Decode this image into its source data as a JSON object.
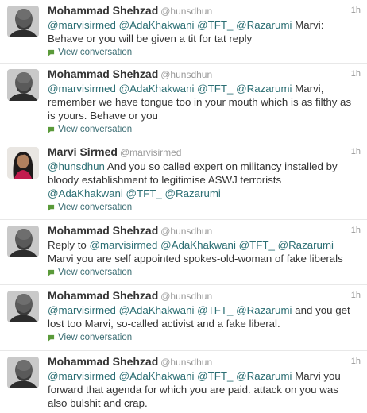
{
  "tweets": [
    {
      "author": "Mohammad Shehzad",
      "handle": "@hunsdhun",
      "time": "1h",
      "avatar": "bald-man-avatar",
      "segments": [
        {
          "t": "@marvisirmed",
          "m": true
        },
        {
          "t": " ",
          "m": false
        },
        {
          "t": "@AdaKhakwani",
          "m": true
        },
        {
          "t": " ",
          "m": false
        },
        {
          "t": "@TFT_",
          "m": true
        },
        {
          "t": " ",
          "m": false
        },
        {
          "t": "@Razarumi",
          "m": true
        },
        {
          "t": " Marvi: Behave or you will be given a tit for tat reply",
          "m": false
        }
      ],
      "action": "View conversation"
    },
    {
      "author": "Mohammad Shehzad",
      "handle": "@hunsdhun",
      "time": "1h",
      "avatar": "bald-man-avatar",
      "segments": [
        {
          "t": "@marvisirmed",
          "m": true
        },
        {
          "t": " ",
          "m": false
        },
        {
          "t": "@AdaKhakwani",
          "m": true
        },
        {
          "t": " ",
          "m": false
        },
        {
          "t": "@TFT_",
          "m": true
        },
        {
          "t": " ",
          "m": false
        },
        {
          "t": "@Razarumi",
          "m": true
        },
        {
          "t": " Marvi, remember we have tongue too in your mouth which is as filthy as is yours. Behave or you",
          "m": false
        }
      ],
      "action": "View conversation"
    },
    {
      "author": "Marvi Sirmed",
      "handle": "@marvisirmed",
      "time": "1h",
      "avatar": "woman-avatar",
      "segments": [
        {
          "t": "@hunsdhun",
          "m": true
        },
        {
          "t": " And you so called expert on militancy installed by bloody establishment to legitimise ASWJ terrorists ",
          "m": false
        },
        {
          "t": "@AdaKhakwani",
          "m": true
        },
        {
          "t": " ",
          "m": false
        },
        {
          "t": "@TFT_",
          "m": true
        },
        {
          "t": " ",
          "m": false
        },
        {
          "t": "@Razarumi",
          "m": true
        }
      ],
      "action": "View conversation"
    },
    {
      "author": "Mohammad Shehzad",
      "handle": "@hunsdhun",
      "time": "1h",
      "avatar": "bald-man-avatar",
      "segments": [
        {
          "t": "Reply to ",
          "m": false
        },
        {
          "t": "@marvisirmed",
          "m": true
        },
        {
          "t": " ",
          "m": false
        },
        {
          "t": "@AdaKhakwani",
          "m": true
        },
        {
          "t": " ",
          "m": false
        },
        {
          "t": "@TFT_",
          "m": true
        },
        {
          "t": " ",
          "m": false
        },
        {
          "t": "@Razarumi",
          "m": true
        },
        {
          "t": " Marvi you are self appointed spokes-old-woman of fake liberals",
          "m": false
        }
      ],
      "action": "View conversation"
    },
    {
      "author": "Mohammad Shehzad",
      "handle": "@hunsdhun",
      "time": "1h",
      "avatar": "bald-man-avatar",
      "segments": [
        {
          "t": "@marvisirmed",
          "m": true
        },
        {
          "t": " ",
          "m": false
        },
        {
          "t": "@AdaKhakwani",
          "m": true
        },
        {
          "t": " ",
          "m": false
        },
        {
          "t": "@TFT_",
          "m": true
        },
        {
          "t": " ",
          "m": false
        },
        {
          "t": "@Razarumi",
          "m": true
        },
        {
          "t": " and you get lost too Marvi, so-called activist and  a fake liberal.",
          "m": false
        }
      ],
      "action": "View conversation"
    },
    {
      "author": "Mohammad Shehzad",
      "handle": "@hunsdhun",
      "time": "1h",
      "avatar": "bald-man-avatar",
      "segments": [
        {
          "t": "@marvisirmed",
          "m": true
        },
        {
          "t": " ",
          "m": false
        },
        {
          "t": "@AdaKhakwani",
          "m": true
        },
        {
          "t": " ",
          "m": false
        },
        {
          "t": "@TFT_",
          "m": true
        },
        {
          "t": " ",
          "m": false
        },
        {
          "t": "@Razarumi",
          "m": true
        },
        {
          "t": " Marvi you forward that agenda for which you are paid. attack on you was also bulshit and crap.",
          "m": false
        }
      ],
      "action": ""
    }
  ]
}
